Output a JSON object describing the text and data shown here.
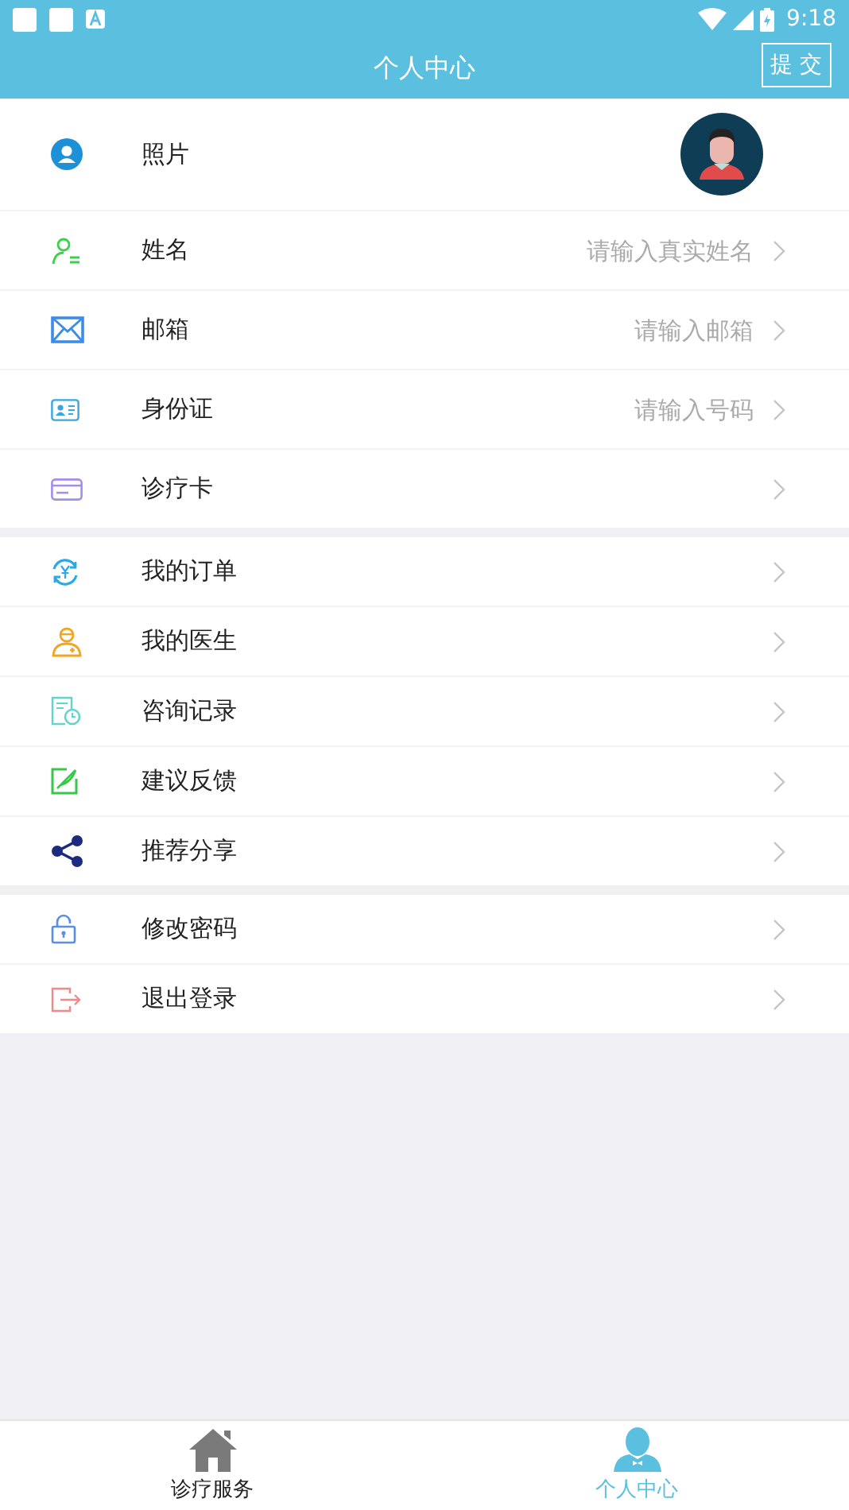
{
  "status_bar": {
    "time": "9:18"
  },
  "header": {
    "title": "个人中心",
    "submit_button": "提 交"
  },
  "groups": [
    {
      "items": [
        {
          "label": "照片"
        },
        {
          "kind": "field",
          "label": "姓名",
          "placeholder": "请输入真实姓名"
        },
        {
          "kind": "field",
          "label": "邮箱",
          "placeholder": "请输入邮箱"
        },
        {
          "kind": "field",
          "label": "身份证",
          "placeholder": "请输入号码"
        },
        {
          "kind": "link",
          "label": "诊疗卡"
        }
      ]
    },
    {
      "items": [
        {
          "kind": "link",
          "label": "我的订单"
        },
        {
          "kind": "link",
          "label": "我的医生"
        },
        {
          "kind": "link",
          "label": "咨询记录"
        },
        {
          "kind": "link",
          "label": "建议反馈"
        },
        {
          "kind": "link",
          "label": "推荐分享"
        }
      ]
    },
    {
      "items": [
        {
          "kind": "link",
          "label": "修改密码"
        },
        {
          "kind": "link",
          "label": "退出登录"
        }
      ]
    }
  ],
  "tabs": [
    {
      "label": "诊疗服务",
      "selected": false
    },
    {
      "label": "个人中心",
      "selected": true
    }
  ]
}
